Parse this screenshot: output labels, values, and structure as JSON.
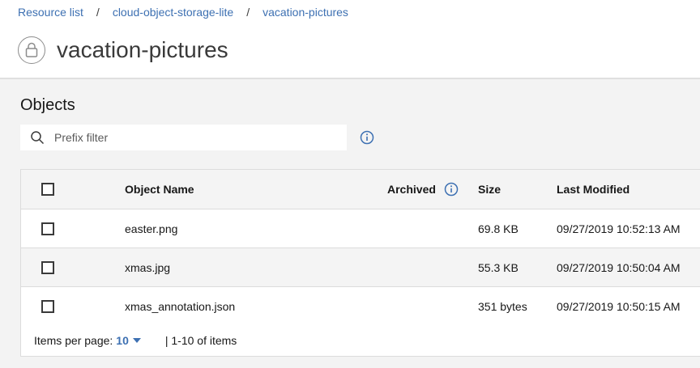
{
  "breadcrumb": {
    "items": [
      "Resource list",
      "cloud-object-storage-lite",
      "vacation-pictures"
    ],
    "separator": "/"
  },
  "page": {
    "title": "vacation-pictures",
    "icon": "bucket-lock-icon"
  },
  "objects": {
    "section_title": "Objects",
    "search_placeholder": "Prefix filter",
    "columns": {
      "name": "Object Name",
      "archived": "Archived",
      "size": "Size",
      "modified": "Last Modified"
    },
    "rows": [
      {
        "name": "easter.png",
        "archived": "",
        "size": "69.8 KB",
        "modified": "09/27/2019 10:52:13 AM"
      },
      {
        "name": "xmas.jpg",
        "archived": "",
        "size": "55.3 KB",
        "modified": "09/27/2019 10:50:04 AM"
      },
      {
        "name": "xmas_annotation.json",
        "archived": "",
        "size": "351 bytes",
        "modified": "09/27/2019 10:50:15 AM"
      }
    ]
  },
  "pagination": {
    "label": "Items per page:",
    "value": "10",
    "range": "| 1-10 of items"
  },
  "colors": {
    "link": "#3d70b2",
    "info": "#3d70b2"
  }
}
